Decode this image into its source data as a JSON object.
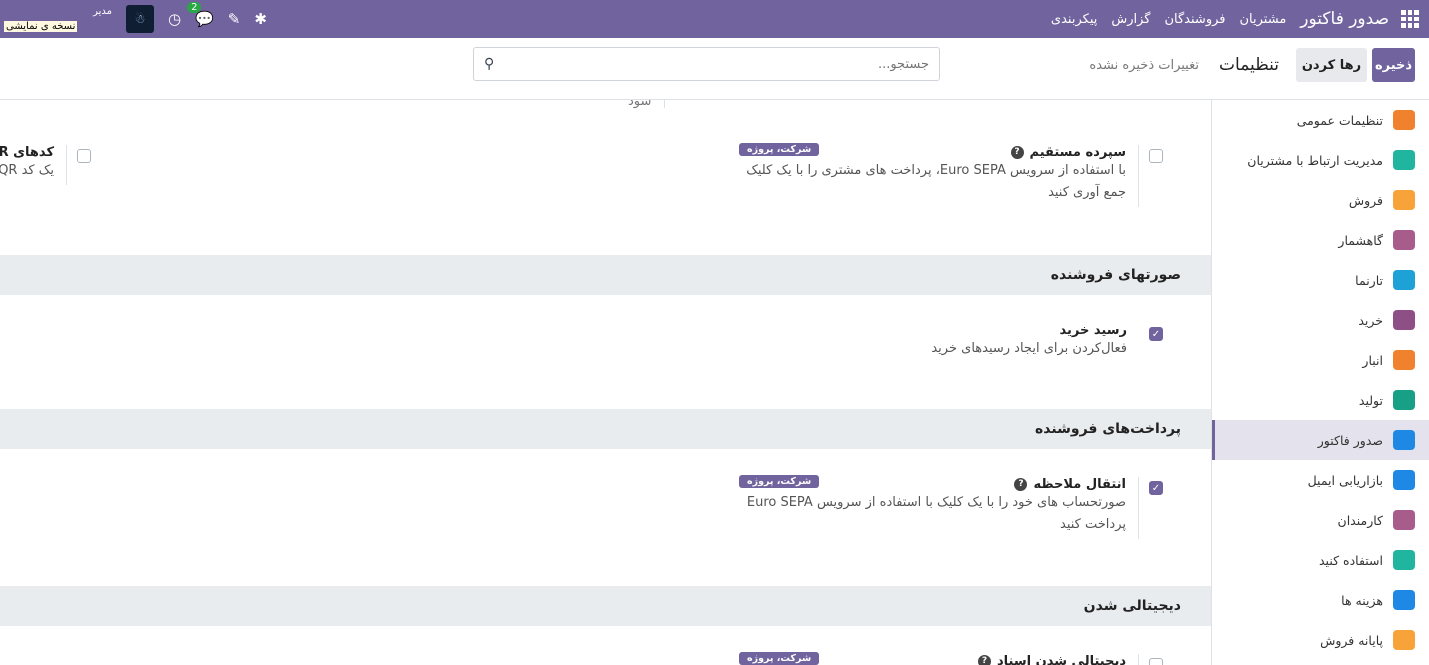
{
  "nav": {
    "brand": "صدور فاکتور",
    "menu": [
      "مشتریان",
      "فروشندگان",
      "گزارش",
      "پیکربندی"
    ],
    "user": "مدیر",
    "demo": "نسخه ی نمایشی",
    "chat_count": "2"
  },
  "control": {
    "save": "ذخیره",
    "discard": "رها کردن",
    "title": "تنظیمات",
    "unsaved": "تغییرات ذخیره نشده",
    "search_placeholder": "جستجو..."
  },
  "sidebar": [
    {
      "label": "تنظیمات عمومی",
      "color": "#f0812d"
    },
    {
      "label": "مدیریت ارتباط با مشتریان",
      "color": "#1fb59e"
    },
    {
      "label": "فروش",
      "color": "#f7a33a"
    },
    {
      "label": "گاهشمار",
      "color": "#a75c8c"
    },
    {
      "label": "تارنما",
      "color": "#1ea1d6"
    },
    {
      "label": "خرید",
      "color": "#8e4f86"
    },
    {
      "label": "انبار",
      "color": "#f0812d"
    },
    {
      "label": "تولید",
      "color": "#17a085"
    },
    {
      "label": "صدور فاکتور",
      "color": "#1e88e5",
      "active": true
    },
    {
      "label": "بازاریابی ایمیل",
      "color": "#1e88e5"
    },
    {
      "label": "کارمندان",
      "color": "#a75c8c"
    },
    {
      "label": "استفاده کنید",
      "color": "#1fb59e"
    },
    {
      "label": "هزینه ها",
      "color": "#1e88e5"
    },
    {
      "label": "پایانه فروش",
      "color": "#f7a33a"
    }
  ],
  "content": {
    "partial_text": "سود",
    "direct_debit": {
      "label": "سپرده مستقیم",
      "desc": "با استفاده از سرویس Euro SEPA، پرداخت های مشتری را با یک کلیک جمع آوری کنید",
      "tag": "شرکت، پروژه",
      "checked": false
    },
    "qr": {
      "label": "کدهای QR",
      "desc": "یک کد QR به فاکتورهای خود اضافه کن",
      "checked": false
    },
    "vendor_bills": {
      "title": "صورتهای فروشنده",
      "receipt_label": "رسید خرید",
      "receipt_desc": "فعال‌کردن برای ایجاد رسیدهای خرید",
      "checked": true
    },
    "vendor_payments": {
      "title": "پرداخت‌های فروشنده",
      "transfer_label": "انتقال ملاحظه",
      "transfer_desc": "صورتحساب های خود را با یک کلیک با استفاده از سرویس Euro SEPA پرداخت کنید",
      "tag": "شرکت، پروژه",
      "checked": true
    },
    "digitization": {
      "title": "دیجیتالی شدن",
      "doc_label": "دیجیتالی شدن اسناد",
      "tag": "شرکت، پروژه",
      "checked": false
    }
  }
}
